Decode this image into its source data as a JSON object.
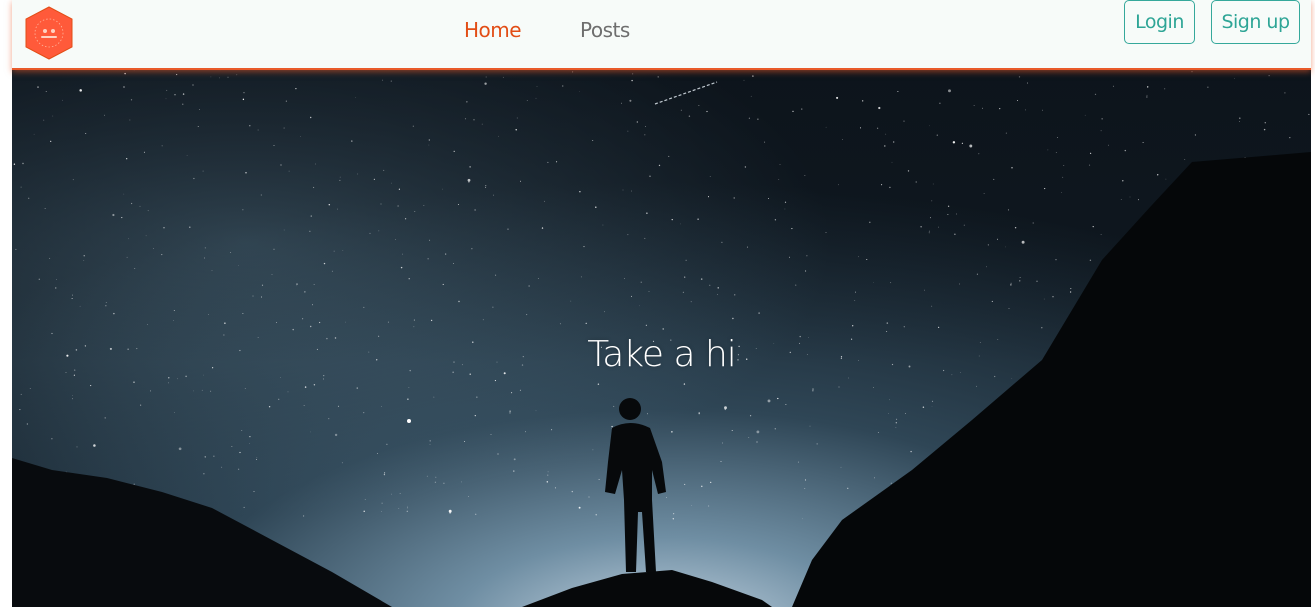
{
  "nav": {
    "logo_icon": "hexagon-logo-icon",
    "links": [
      {
        "label": "Home",
        "active": true
      },
      {
        "label": "Posts",
        "active": false
      }
    ],
    "login_label": "Login",
    "signup_label": "Sign up"
  },
  "hero": {
    "title": "Take a hi",
    "background": "starry-night-silhouette-image"
  },
  "colors": {
    "accent": "#e24d16",
    "nav_bg": "#f7fbf9",
    "button_teal": "#2ea596",
    "link_gray": "#6e6e6e",
    "hero_title": "#ffffff"
  }
}
